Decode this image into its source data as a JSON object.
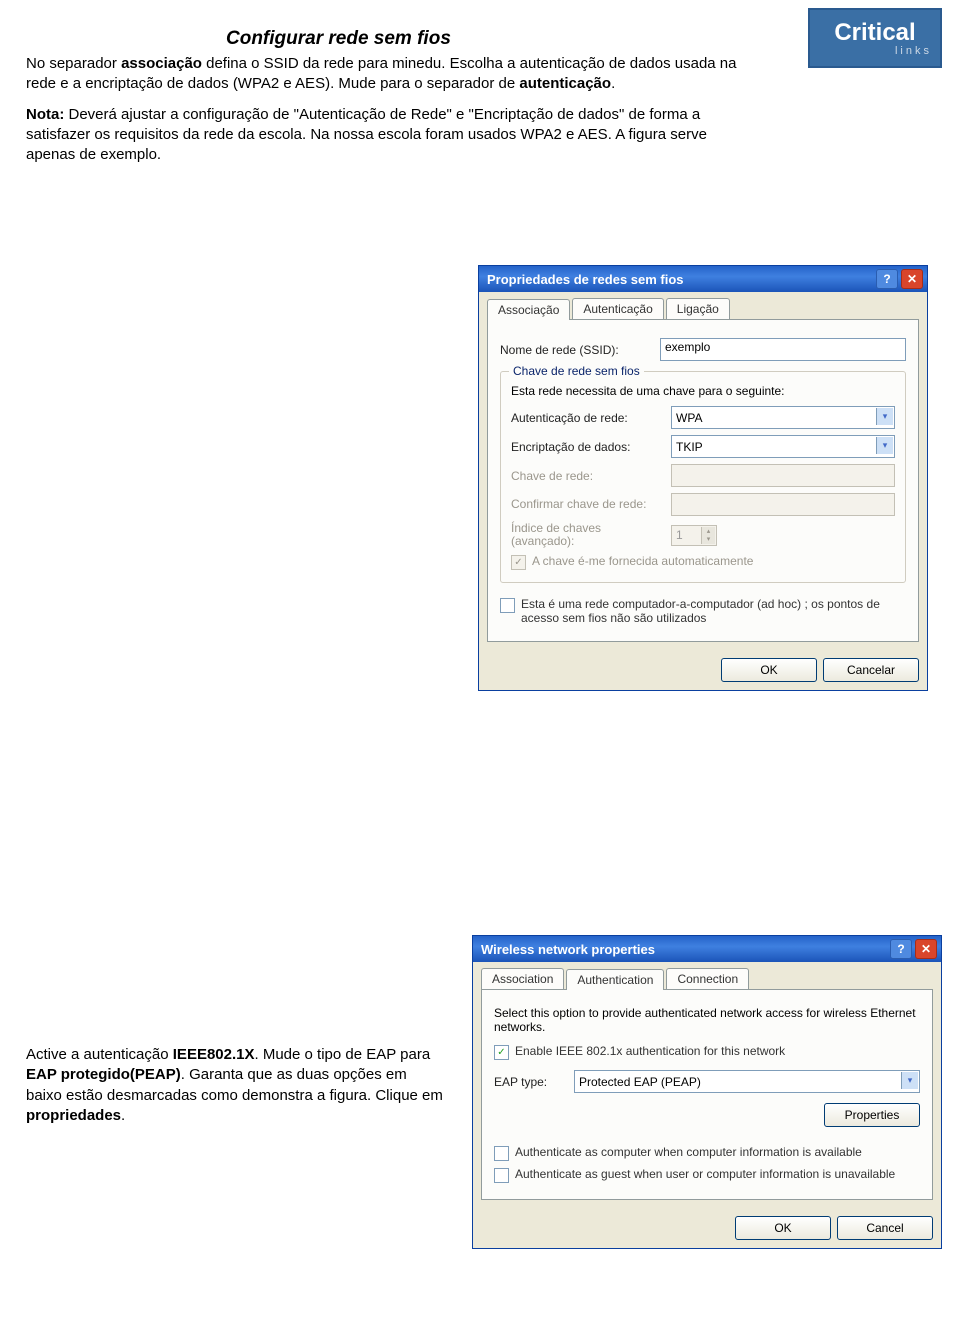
{
  "logo": {
    "brand": "Critical",
    "sub": "links"
  },
  "doc": {
    "title": "Configurar rede sem fios",
    "p1a": "No separador ",
    "p1b": "associação",
    "p1c": " defina o SSID da rede para minedu. Escolha a autenticação de dados usada na rede e a encriptação de dados (WPA2 e AES). Mude para o separador de ",
    "p1d": "autenticação",
    "p1e": ".",
    "note_lead": "Nota:",
    "note_body": " Deverá ajustar a configuração de \"Autenticação de Rede\" e \"Encriptação de dados\" de forma a satisfazer os requisitos da rede da escola. Na nossa escola foram usados WPA2 e AES.  A figura serve apenas de exemplo.",
    "p2a": "Active a autenticação ",
    "p2b": "IEEE802.1X",
    "p2c": ". Mude o tipo de EAP para ",
    "p2d": "EAP protegido(PEAP)",
    "p2e": ". Garanta que as duas opções em baixo estão desmarcadas como demonstra a figura. Clique em ",
    "p2f": "propriedades",
    "p2g": "."
  },
  "win1": {
    "title": "Propriedades de redes sem fios",
    "tabs": [
      "Associação",
      "Autenticação",
      "Ligação"
    ],
    "ssid_label": "Nome de rede (SSID):",
    "ssid_value": "exemplo",
    "group_title": "Chave de rede sem fios",
    "group_text": "Esta rede necessita de uma chave para o seguinte:",
    "auth_label": "Autenticação de rede:",
    "auth_value": "WPA",
    "enc_label": "Encriptação de dados:",
    "enc_value": "TKIP",
    "key_label": "Chave de rede:",
    "key2_label": "Confirmar chave de rede:",
    "idx_label": "Índice de chaves (avançado):",
    "idx_value": "1",
    "auto_label": "A chave é-me fornecida automaticamente",
    "adhoc_label": "Esta é uma rede computador-a-computador (ad hoc) ; os pontos de acesso sem fios não são utilizados",
    "ok": "OK",
    "cancel": "Cancelar"
  },
  "win2": {
    "title": "Wireless network properties",
    "tabs": [
      "Association",
      "Authentication",
      "Connection"
    ],
    "desc": "Select this option to provide authenticated network access for wireless Ethernet networks.",
    "enable_label": "Enable IEEE 802.1x authentication for this network",
    "eap_label": "EAP type:",
    "eap_value": "Protected EAP (PEAP)",
    "properties": "Properties",
    "opt1": "Authenticate as computer when computer information is available",
    "opt2": "Authenticate as guest when user or computer information is unavailable",
    "ok": "OK",
    "cancel": "Cancel"
  }
}
